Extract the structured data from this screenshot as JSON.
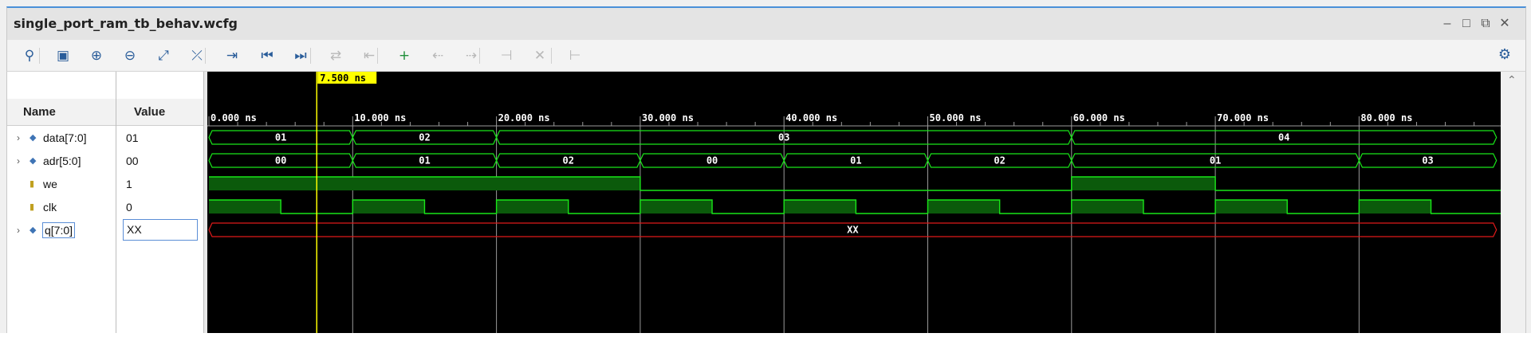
{
  "window": {
    "title": "single_port_ram_tb_behav.wcfg",
    "controls": [
      "–",
      "□",
      "⧉",
      "✕"
    ]
  },
  "toolbar": {
    "icons": [
      {
        "name": "search-icon",
        "glyph": "⚲",
        "enabled": true
      },
      {
        "name": "save-icon",
        "glyph": "▣",
        "enabled": true
      },
      {
        "name": "zoom-in-icon",
        "glyph": "⊕",
        "enabled": true
      },
      {
        "name": "zoom-out-icon",
        "glyph": "⊖",
        "enabled": true
      },
      {
        "name": "zoom-fit-icon",
        "glyph": "⤢",
        "enabled": true
      },
      {
        "name": "cursor-tool-icon",
        "glyph": "⤫",
        "enabled": true
      },
      {
        "name": "goto-cursor-icon",
        "glyph": "⇥",
        "enabled": true
      },
      {
        "name": "goto-start-icon",
        "glyph": "⏮",
        "enabled": true
      },
      {
        "name": "goto-end-icon",
        "glyph": "⏭",
        "enabled": true
      },
      {
        "name": "swap-cursors-icon",
        "glyph": "⇄",
        "enabled": false
      },
      {
        "name": "previous-transition-icon",
        "glyph": "⇤",
        "enabled": false
      },
      {
        "name": "add-marker-icon",
        "glyph": "+",
        "enabled": true
      },
      {
        "name": "previous-marker-icon",
        "glyph": "⇠",
        "enabled": false
      },
      {
        "name": "next-marker-icon",
        "glyph": "⇢",
        "enabled": false
      },
      {
        "name": "goto-marker-icon",
        "glyph": "⊣",
        "enabled": false
      },
      {
        "name": "delete-marker-icon",
        "glyph": "✕",
        "enabled": false
      },
      {
        "name": "snap-icon",
        "glyph": "⊢",
        "enabled": false
      }
    ],
    "settings_icon": "gear-icon"
  },
  "panels": {
    "name_header": "Name",
    "value_header": "Value"
  },
  "signals": [
    {
      "name": "data[7:0]",
      "value": "01",
      "kind": "bus",
      "expandable": true
    },
    {
      "name": "adr[5:0]",
      "value": "00",
      "kind": "bus",
      "expandable": true
    },
    {
      "name": "we",
      "value": "1",
      "kind": "bit",
      "expandable": false
    },
    {
      "name": "clk",
      "value": "0",
      "kind": "bit",
      "expandable": false
    },
    {
      "name": "q[7:0]",
      "value": "XX",
      "kind": "bus",
      "expandable": true,
      "selected": true
    }
  ],
  "waveform": {
    "time_start_ns": 0,
    "time_end_ns": 90,
    "cursor_ns": 7.5,
    "cursor_label": "7.500 ns",
    "ticks": [
      {
        "t": 0,
        "label": "0.000 ns"
      },
      {
        "t": 10,
        "label": "10.000 ns"
      },
      {
        "t": 20,
        "label": "20.000 ns"
      },
      {
        "t": 30,
        "label": "30.000 ns"
      },
      {
        "t": 40,
        "label": "40.000 ns"
      },
      {
        "t": 50,
        "label": "50.000 ns"
      },
      {
        "t": 60,
        "label": "60.000 ns"
      },
      {
        "t": 70,
        "label": "70.000 ns"
      },
      {
        "t": 80,
        "label": "80.000 ns"
      }
    ],
    "tracks": [
      {
        "signal": "data[7:0]",
        "type": "bus",
        "segments": [
          {
            "start": 0,
            "end": 10,
            "label": "01"
          },
          {
            "start": 10,
            "end": 20,
            "label": "02"
          },
          {
            "start": 20,
            "end": 60,
            "label": "03"
          },
          {
            "start": 60,
            "end": 90,
            "label": "04"
          }
        ]
      },
      {
        "signal": "adr[5:0]",
        "type": "bus",
        "segments": [
          {
            "start": 0,
            "end": 10,
            "label": "00"
          },
          {
            "start": 10,
            "end": 20,
            "label": "01"
          },
          {
            "start": 20,
            "end": 30,
            "label": "02"
          },
          {
            "start": 30,
            "end": 40,
            "label": "00"
          },
          {
            "start": 40,
            "end": 50,
            "label": "01"
          },
          {
            "start": 50,
            "end": 60,
            "label": "02"
          },
          {
            "start": 60,
            "end": 80,
            "label": "01"
          },
          {
            "start": 80,
            "end": 90,
            "label": "03"
          }
        ]
      },
      {
        "signal": "we",
        "type": "bit",
        "levels": [
          {
            "start": 0,
            "end": 30,
            "level": 1
          },
          {
            "start": 30,
            "end": 60,
            "level": 0
          },
          {
            "start": 60,
            "end": 70,
            "level": 1
          },
          {
            "start": 70,
            "end": 90,
            "level": 0
          }
        ]
      },
      {
        "signal": "clk",
        "type": "bit",
        "levels": [
          {
            "start": 0,
            "end": 5,
            "level": 1
          },
          {
            "start": 5,
            "end": 10,
            "level": 0
          },
          {
            "start": 10,
            "end": 15,
            "level": 1
          },
          {
            "start": 15,
            "end": 20,
            "level": 0
          },
          {
            "start": 20,
            "end": 25,
            "level": 1
          },
          {
            "start": 25,
            "end": 30,
            "level": 0
          },
          {
            "start": 30,
            "end": 35,
            "level": 1
          },
          {
            "start": 35,
            "end": 40,
            "level": 0
          },
          {
            "start": 40,
            "end": 45,
            "level": 1
          },
          {
            "start": 45,
            "end": 50,
            "level": 0
          },
          {
            "start": 50,
            "end": 55,
            "level": 1
          },
          {
            "start": 55,
            "end": 60,
            "level": 0
          },
          {
            "start": 60,
            "end": 65,
            "level": 1
          },
          {
            "start": 65,
            "end": 70,
            "level": 0
          },
          {
            "start": 70,
            "end": 75,
            "level": 1
          },
          {
            "start": 75,
            "end": 80,
            "level": 0
          },
          {
            "start": 80,
            "end": 85,
            "level": 1
          },
          {
            "start": 85,
            "end": 90,
            "level": 0
          }
        ]
      },
      {
        "signal": "q[7:0]",
        "type": "bus",
        "undefined": true,
        "segments": [
          {
            "start": 0,
            "end": 90,
            "label": "XX"
          }
        ]
      }
    ],
    "colors": {
      "background": "#000000",
      "wave": "#19e619",
      "wave_fill": "#0b5a0b",
      "undefined": "#e01a1a",
      "cursor": "#ffff00",
      "cursor_label_bg": "#ffff00",
      "ruler_text": "#ffffff",
      "grid": "#9a9a9a",
      "bus_text": "#ffffff"
    }
  }
}
